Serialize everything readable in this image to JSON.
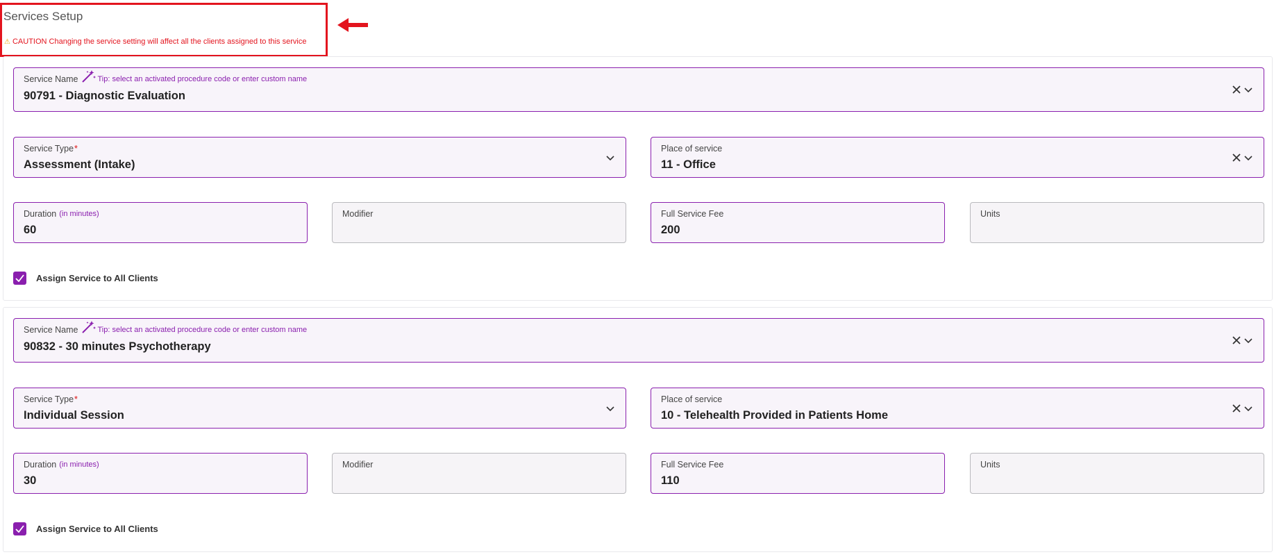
{
  "page": {
    "title": "Services Setup",
    "caution": "CAUTION Changing the service setting will affect all the clients assigned to this service"
  },
  "services": [
    {
      "service_name": {
        "label": "Service Name",
        "tip": "Tip: select an activated procedure code or enter custom name",
        "value": "90791 - Diagnostic Evaluation"
      },
      "service_type": {
        "label": "Service Type",
        "required_mark": "*",
        "value": "Assessment (Intake)"
      },
      "place_of_service": {
        "label": "Place of service",
        "value": "11 - Office"
      },
      "duration": {
        "label": "Duration",
        "hint": "(in minutes)",
        "value": "60"
      },
      "modifier": {
        "label": "Modifier",
        "value": ""
      },
      "full_service_fee": {
        "label": "Full Service Fee",
        "value": "200"
      },
      "units": {
        "label": "Units",
        "value": ""
      },
      "assign_all": {
        "label": "Assign Service to All Clients",
        "checked": true
      }
    },
    {
      "service_name": {
        "label": "Service Name",
        "tip": "Tip: select an activated procedure code or enter custom name",
        "value": "90832 - 30 minutes Psychotherapy"
      },
      "service_type": {
        "label": "Service Type",
        "required_mark": "*",
        "value": "Individual Session"
      },
      "place_of_service": {
        "label": "Place of service",
        "value": "10 - Telehealth Provided in Patients Home"
      },
      "duration": {
        "label": "Duration",
        "hint": "(in minutes)",
        "value": "30"
      },
      "modifier": {
        "label": "Modifier",
        "value": ""
      },
      "full_service_fee": {
        "label": "Full Service Fee",
        "value": "110"
      },
      "units": {
        "label": "Units",
        "value": ""
      },
      "assign_all": {
        "label": "Assign Service to All Clients",
        "checked": true
      }
    }
  ],
  "icons": {
    "wand": "magic-wand-icon",
    "clear": "close-icon",
    "dropdown": "chevron-down-icon",
    "warning": "warning-icon",
    "check": "checkmark-icon",
    "arrow": "arrow-left-icon"
  },
  "colors": {
    "accent": "#8a1fae",
    "caution": "#e3141e",
    "highlight_box": "#e3141e"
  }
}
